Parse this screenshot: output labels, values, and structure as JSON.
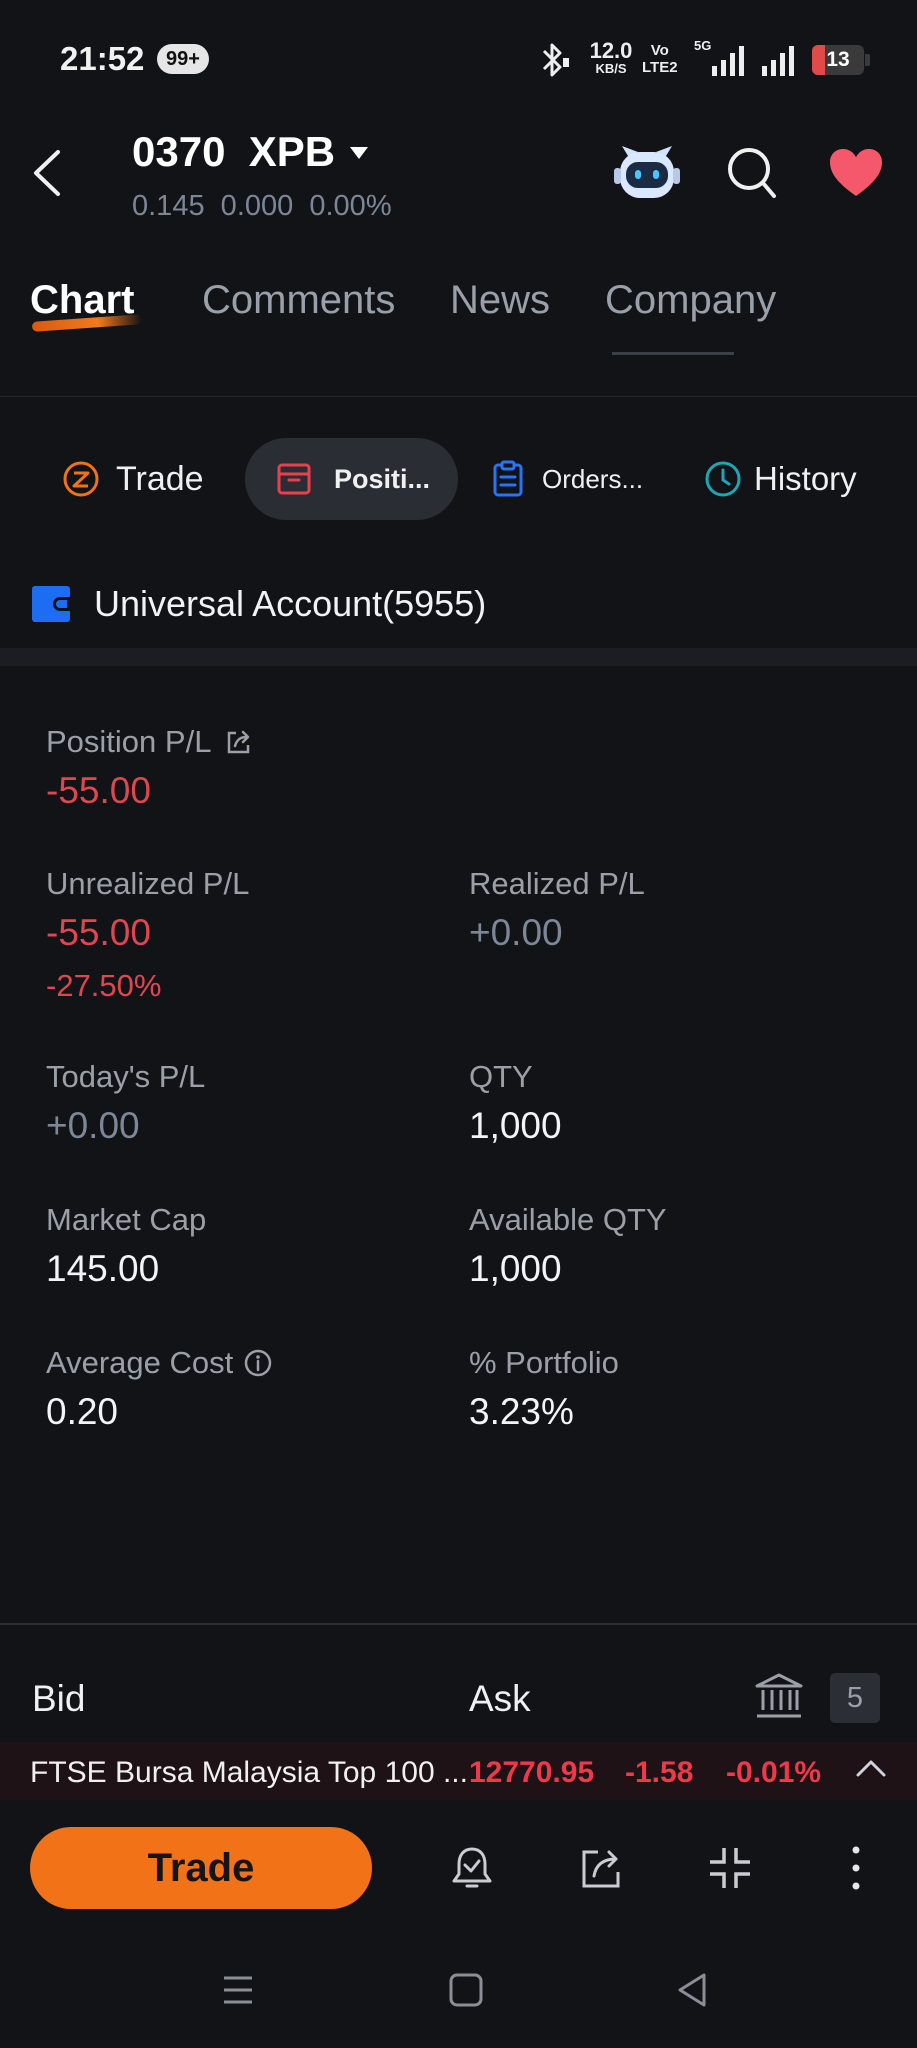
{
  "status_bar": {
    "time": "21:52",
    "notification_badge": "99+",
    "net_speed_value": "12.0",
    "net_speed_unit": "KB/S",
    "volte_top": "Vo",
    "volte_bottom": "LTE2",
    "network_type": "5G",
    "battery_level": "13"
  },
  "header": {
    "title": "0370  XPB",
    "price_line": "0.145  0.000  0.00%",
    "icons": [
      "back-icon",
      "dropdown-caret-icon",
      "robot-assistant-icon",
      "search-icon",
      "favorite-heart-icon"
    ]
  },
  "tabs": [
    {
      "label": "Chart",
      "active": true
    },
    {
      "label": "Comments",
      "active": false
    },
    {
      "label": "News",
      "active": false
    },
    {
      "label": "Company",
      "active": false
    }
  ],
  "subtabs": [
    {
      "label": "Trade",
      "icon": "trade-icon",
      "active": false
    },
    {
      "label": "Positi...",
      "icon": "positions-icon",
      "active": true
    },
    {
      "label": "Orders...",
      "icon": "orders-icon",
      "active": false
    },
    {
      "label": "History",
      "icon": "history-icon",
      "active": false
    }
  ],
  "account": {
    "label": "Universal Account(5955)"
  },
  "position": {
    "position_pl_label": "Position P/L",
    "position_pl_value": "-55.00",
    "unrealized_label": "Unrealized P/L",
    "unrealized_value": "-55.00",
    "unrealized_pct": "-27.50%",
    "realized_label": "Realized P/L",
    "realized_value": "+0.00",
    "today_label": "Today's P/L",
    "today_value": "+0.00",
    "qty_label": "QTY",
    "qty_value": "1,000",
    "market_cap_label": "Market Cap",
    "market_cap_value": "145.00",
    "available_qty_label": "Available QTY",
    "available_qty_value": "1,000",
    "avg_cost_label": "Average Cost",
    "avg_cost_value": "0.20",
    "portfolio_label": "% Portfolio",
    "portfolio_value": "3.23%"
  },
  "bid_ask": {
    "bid_label": "Bid",
    "ask_label": "Ask",
    "count": "5"
  },
  "ticker": {
    "name": "FTSE Bursa Malaysia Top 100 ...",
    "value": "12770.95",
    "change": "-1.58",
    "change_pct": "-0.01%"
  },
  "bottom_bar": {
    "trade_label": "Trade"
  },
  "colors": {
    "background": "#111317",
    "accent_orange": "#f27217",
    "negative_red": "#e04650",
    "neutral_gray": "#7d8798",
    "account_blue": "#1d6df2"
  }
}
